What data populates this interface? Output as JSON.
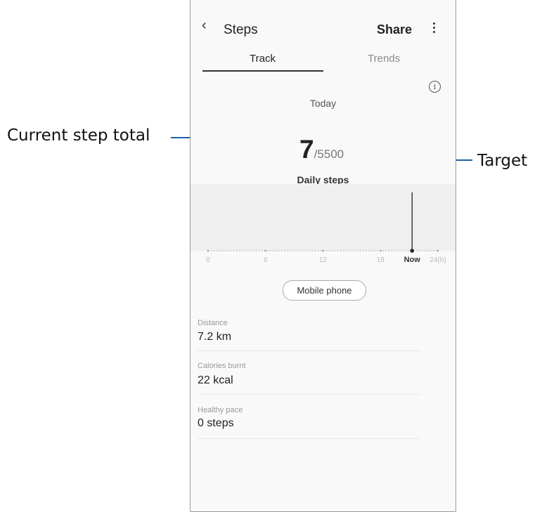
{
  "appbar": {
    "back_icon": "chevron-left-icon",
    "title": "Steps",
    "share": "Share",
    "more_icon": "more-vertical-icon"
  },
  "tabs": [
    {
      "label": "Track",
      "active": true
    },
    {
      "label": "Trends",
      "active": false
    }
  ],
  "summary": {
    "info_icon": "info-icon",
    "day": "Today",
    "current": "7",
    "target": "/5500",
    "caption": "Daily steps"
  },
  "chart_data": {
    "type": "bar",
    "x": [
      0,
      6,
      12,
      18,
      "Now",
      24
    ],
    "tick_labels": [
      "0",
      "6",
      "12",
      "18",
      "Now",
      "24(h)"
    ],
    "now_position_hour": 21.3,
    "title": "",
    "xlabel": "",
    "ylabel": ""
  },
  "device_button": "Mobile phone",
  "stats": [
    {
      "label": "Distance",
      "value": "7.2 km"
    },
    {
      "label": "Calories burnt",
      "value": "22 kcal"
    },
    {
      "label": "Healthy pace",
      "value": "0 steps"
    }
  ],
  "callouts": {
    "left": "Current step total",
    "right": "Target"
  },
  "colors": {
    "callout_line": "#1f5fa8"
  }
}
